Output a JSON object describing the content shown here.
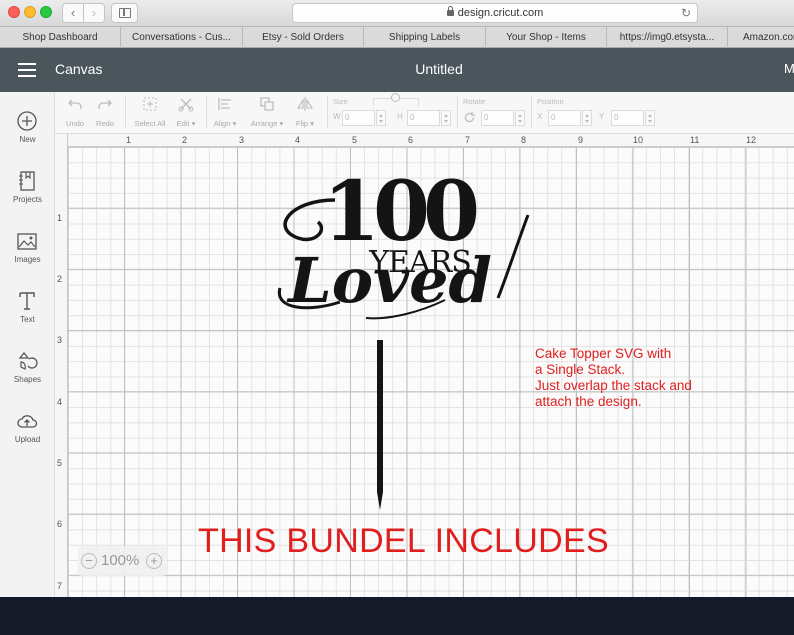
{
  "browser": {
    "url": "design.cricut.com",
    "bookmarks": [
      "Shop Dashboard",
      "Conversations - Cus...",
      "Etsy - Sold Orders",
      "Shipping Labels",
      "Your Shop - Items",
      "https://img0.etsysta...",
      "Amazon.com"
    ]
  },
  "header": {
    "app_title": "Canvas",
    "doc_title": "Untitled",
    "right_initial": "M"
  },
  "tools": [
    {
      "label": "New",
      "icon": "plus-circle-icon"
    },
    {
      "label": "Projects",
      "icon": "notebook-icon"
    },
    {
      "label": "Images",
      "icon": "image-icon"
    },
    {
      "label": "Text",
      "icon": "text-t-icon"
    },
    {
      "label": "Shapes",
      "icon": "shapes-icon"
    },
    {
      "label": "Upload",
      "icon": "upload-cloud-icon"
    }
  ],
  "edit_toolbar": {
    "undo": "Undo",
    "redo": "Redo",
    "select_all": "Select All",
    "edit": "Edit",
    "align": "Align",
    "arrange": "Arrange",
    "flip": "Flip",
    "size_label": "Size",
    "size_w_prefix": "W",
    "size_w": "0",
    "size_h_prefix": "H",
    "size_h": "0",
    "rotate_label": "Rotate",
    "rotate_value": "0",
    "position_label": "Position",
    "pos_x_prefix": "X",
    "pos_x": "0",
    "pos_y_prefix": "Y",
    "pos_y": "0"
  },
  "ruler": {
    "x": [
      "1",
      "2",
      "3",
      "4",
      "5",
      "6",
      "7",
      "8",
      "9",
      "10",
      "11",
      "12"
    ],
    "y": [
      "1",
      "2",
      "3",
      "4",
      "5",
      "6",
      "7"
    ]
  },
  "design": {
    "number": "100",
    "years": "YEARS",
    "loved": "Loved"
  },
  "note": {
    "lines": [
      "Cake Topper SVG with",
      "a Single Stack.",
      "Just overlap the stack and",
      "attach the design."
    ]
  },
  "headline": "THIS BUNDEL INCLUDES",
  "zoom": {
    "minus": "−",
    "value": "100%",
    "plus": "+"
  }
}
